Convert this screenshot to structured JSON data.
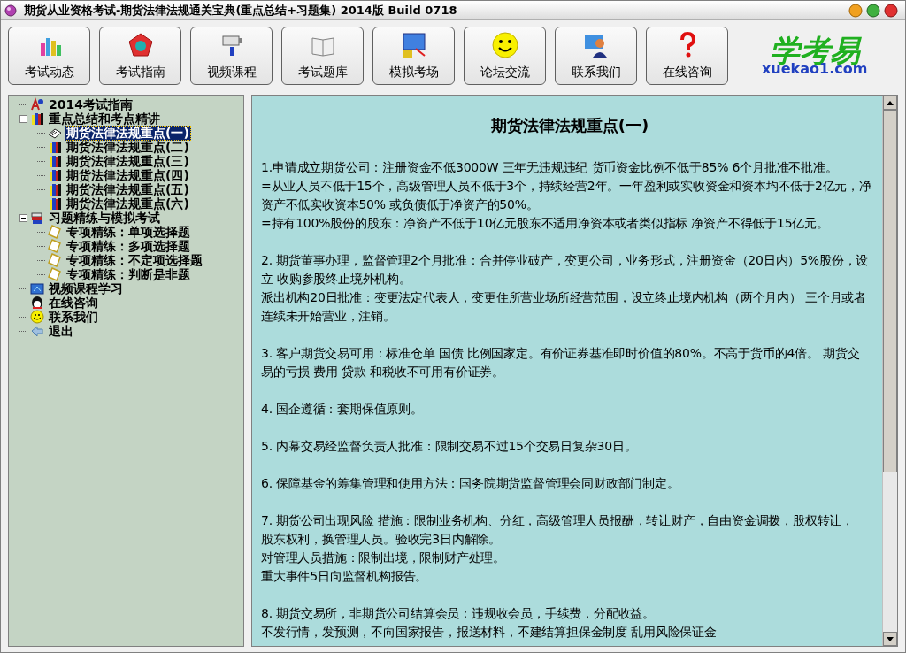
{
  "window": {
    "title": "期货从业资格考试-期货法律法规通关宝典(重点总结+习题集) 2014版 Build 0718"
  },
  "toolbar": [
    {
      "label": "考试动态",
      "kind": "chart"
    },
    {
      "label": "考试指南",
      "kind": "pentagon"
    },
    {
      "label": "视频课程",
      "kind": "camera"
    },
    {
      "label": "考试题库",
      "kind": "book"
    },
    {
      "label": "模拟考场",
      "kind": "screen"
    },
    {
      "label": "论坛交流",
      "kind": "smiley"
    },
    {
      "label": "联系我们",
      "kind": "person"
    },
    {
      "label": "在线咨询",
      "kind": "question"
    }
  ],
  "logo": {
    "title": "学考易",
    "site": "xuekao1.com"
  },
  "tree": [
    {
      "label": "2014考试指南",
      "kind": "guide",
      "selected": false
    },
    {
      "label": "重点总结和考点精讲",
      "kind": "books",
      "selected": false,
      "expanded": true,
      "children": [
        {
          "label": "期货法律法规重点(一)",
          "kind": "openbook",
          "selected": true
        },
        {
          "label": "期货法律法规重点(二)",
          "kind": "books",
          "selected": false
        },
        {
          "label": "期货法律法规重点(三)",
          "kind": "books",
          "selected": false
        },
        {
          "label": "期货法律法规重点(四)",
          "kind": "books",
          "selected": false
        },
        {
          "label": "期货法律法规重点(五)",
          "kind": "books",
          "selected": false
        },
        {
          "label": "期货法律法规重点(六)",
          "kind": "books",
          "selected": false
        }
      ]
    },
    {
      "label": "习题精练与模拟考试",
      "kind": "stack",
      "selected": false,
      "expanded": true,
      "children": [
        {
          "label": "专项精练：单项选择题",
          "kind": "note",
          "selected": false
        },
        {
          "label": "专项精练：多项选择题",
          "kind": "note",
          "selected": false
        },
        {
          "label": "专项精练：不定项选择题",
          "kind": "note",
          "selected": false
        },
        {
          "label": "专项精练：判断是非题",
          "kind": "note",
          "selected": false
        }
      ]
    },
    {
      "label": "视频课程学习",
      "kind": "video",
      "selected": false
    },
    {
      "label": "在线咨询",
      "kind": "penguin",
      "selected": false
    },
    {
      "label": "联系我们",
      "kind": "smiley",
      "selected": false
    },
    {
      "label": "退出",
      "kind": "exit",
      "selected": false
    }
  ],
  "article": {
    "title": "期货法律法规重点(一)",
    "paragraphs": [
      [
        "1.申请成立期货公司：注册资金不低3000W 三年无违规违纪  货币资金比例不低于85%  6个月批准不批准。",
        "=从业人员不低于15个，高级管理人员不低于3个，持续经营2年。一年盈利或实收资金和资本均不低于2亿元，净",
        "资产不低实收资本50% 或负债低于净资产的50%。",
        "=持有100%股份的股东：净资产不低于10亿元股东不适用净资本或者类似指标  净资产不得低于15亿元。"
      ],
      [
        "2. 期货董事办理，监督管理2个月批准：合并停业破产，变更公司，业务形式，注册资金（20日内）5%股份，设",
        "立  收购参股终止境外机构。",
        "派出机构20日批准：变更法定代表人，变更住所营业场所经营范围，设立终止境内机构（两个月内）  三个月或者",
        "连续未开始营业，注销。"
      ],
      [
        "3. 客户期货交易可用：标准仓单  国债  比例国家定。有价证券基准即时价值的80%。不高于货币的4倍。   期货交",
        "易的亏损  费用  贷款  和税收不可用有价证券。"
      ],
      [
        "4. 国企遵循：套期保值原则。"
      ],
      [
        "5. 内幕交易经监督负责人批准：限制交易不过15个交易日复杂30日。"
      ],
      [
        "6. 保障基金的筹集管理和使用方法：国务院期货监督管理会同财政部门制定。"
      ],
      [
        "7. 期货公司出现风险  措施：限制业务机构、分红，高级管理人员报酬，转让财产，自由资金调拨，股权转让，",
        "股东权利，换管理人员。验收完3日内解除。",
        "对管理人员措施：限制出境，限制财产处理。",
        "重大事件5日向监督机构报告。"
      ],
      [
        "8. 期货交易所，非期货公司结算会员：违规收会员，手续费，分配收益。",
        "不发行情，发预测，不向国家报告，报送材料，不建结算担保金制度  乱用风险保证金"
      ]
    ]
  }
}
